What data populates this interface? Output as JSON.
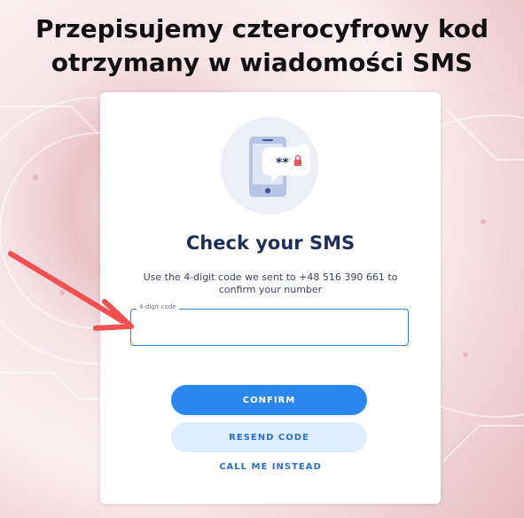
{
  "headline": {
    "line1": "Przepisujemy czterocyfrowy kod",
    "line2": "otrzymany w wiadomości SMS"
  },
  "card": {
    "illustration_icon": "phone-sms-code-icon",
    "masked_code_text": "**",
    "title": "Check your SMS",
    "description": "Use the 4-digit code we sent to +48 516 390 661 to confirm your number",
    "code_field": {
      "label": "4-digit code",
      "value": ""
    },
    "confirm_label": "CONFIRM",
    "resend_label": "RESEND CODE",
    "call_label": "CALL ME INSTEAD"
  },
  "colors": {
    "primary": "#2a87ef",
    "secondary_bg": "#dfeefe",
    "title": "#1f2f5c",
    "annotation_arrow": "#f0504f"
  }
}
